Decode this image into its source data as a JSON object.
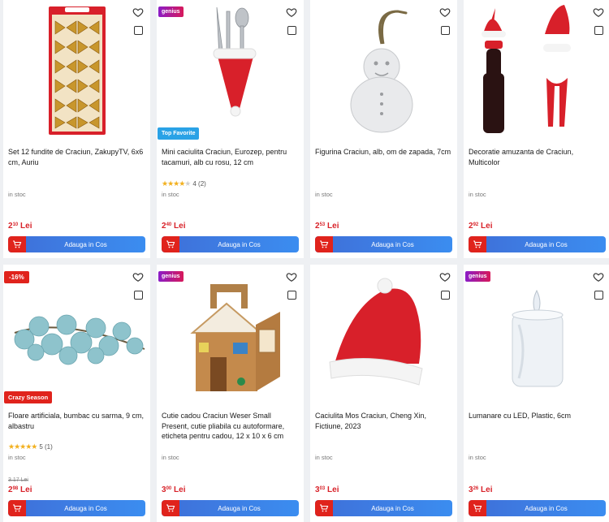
{
  "common": {
    "add_to_cart": "Adauga in Cos",
    "stock": "in stoc",
    "currency": "Lei",
    "genius": "genius"
  },
  "products": [
    {
      "title": "Set 12 fundite de Craciun, ZakupyTV, 6x6 cm, Auriu",
      "price_int": "2",
      "price_dec": "10"
    },
    {
      "title": "Mini caciulita Craciun, Eurozep, pentru tacamuri, alb cu rosu, 12 cm",
      "price_int": "2",
      "price_dec": "40",
      "badge_bottom": "Top Favorite",
      "rating_text": "4 (2)",
      "rating": 4
    },
    {
      "title": "Figurina Craciun, alb, om de zapada, 7cm",
      "price_int": "2",
      "price_dec": "53"
    },
    {
      "title": "Decoratie amuzanta de Craciun, Multicolor",
      "price_int": "2",
      "price_dec": "92"
    },
    {
      "title": "Floare artificiala, bumbac cu sarma, 9 cm, albastru",
      "price_int": "2",
      "price_dec": "98",
      "old_price": "3.17 Lei",
      "badge_top": "-16%",
      "badge_bottom": "Crazy Season",
      "rating_text": "5 (1)",
      "rating": 5
    },
    {
      "title": "Cutie cadou Craciun Weser Small Present, cutie pliabila cu autoformare, eticheta pentru cadou, 12 x 10 x 6 cm",
      "price_int": "3",
      "price_dec": "00"
    },
    {
      "title": "Caciulita Mos Craciun, Cheng Xin, Fictiune, 2023",
      "price_int": "3",
      "price_dec": "03"
    },
    {
      "title": "Lumanare cu LED, Plastic, 6cm",
      "price_int": "3",
      "price_dec": "26"
    }
  ],
  "colors": {
    "price": "#d8232a",
    "button": "#3b7ee8",
    "cart": "#e0231c"
  }
}
